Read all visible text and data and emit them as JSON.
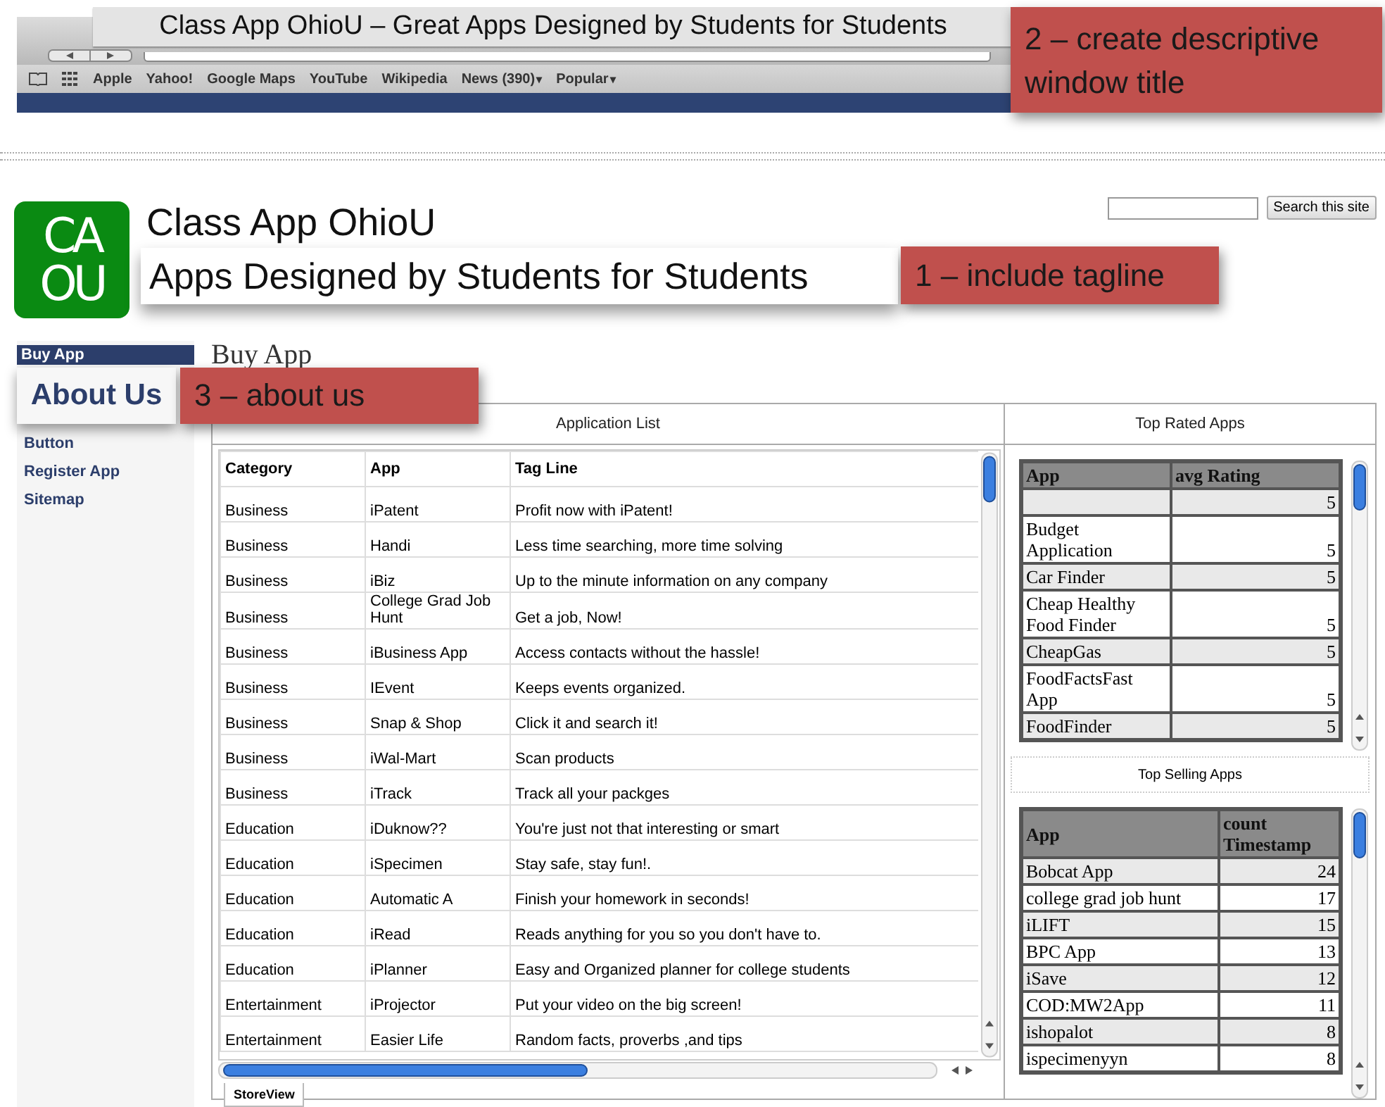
{
  "browser": {
    "window_title": "Class App OhioU – Great Apps Designed by Students for Students",
    "bookmarks": [
      {
        "label": "Apple"
      },
      {
        "label": "Yahoo!"
      },
      {
        "label": "Google Maps"
      },
      {
        "label": "YouTube"
      },
      {
        "label": "Wikipedia"
      },
      {
        "label": "News (390)",
        "caret": "▾"
      },
      {
        "label": "Popular",
        "caret": "▾"
      }
    ]
  },
  "callouts": [
    {
      "kind": "title",
      "text": "2 – create descriptive window title"
    },
    {
      "kind": "tagline",
      "text": "1 – include tagline"
    },
    {
      "kind": "about",
      "text": "3 – about us"
    }
  ],
  "site": {
    "logo_letters": [
      "CA",
      "OU"
    ],
    "title": "Class App OhioU",
    "tagline": "Apps Designed by Students for Students"
  },
  "search": {
    "button": "Search this site"
  },
  "sidebar": {
    "items": [
      {
        "label": "Buy App",
        "selected": true
      },
      {
        "label": "Button",
        "selected": false
      },
      {
        "label": "Register App",
        "selected": false
      },
      {
        "label": "Sitemap",
        "selected": false
      }
    ],
    "highlight": "About Us"
  },
  "page_heading": "Buy App",
  "application_list": {
    "title": "Application List",
    "columns": [
      "Category",
      "App",
      "Tag Line"
    ],
    "rows": [
      [
        "Business",
        "iPatent",
        "Profit now with iPatent!"
      ],
      [
        "Business",
        "Handi",
        "Less time searching, more time solving"
      ],
      [
        "Business",
        "iBiz",
        "Up to the minute information on any company"
      ],
      [
        "Business",
        "College Grad Job Hunt",
        "Get a job, Now!"
      ],
      [
        "Business",
        "iBusiness App",
        "Access contacts without the hassle!"
      ],
      [
        "Business",
        "IEvent",
        "Keeps events organized."
      ],
      [
        "Business",
        "Snap & Shop",
        "Click it and search it!"
      ],
      [
        "Business",
        "iWal-Mart",
        "Scan products"
      ],
      [
        "Business",
        "iTrack",
        "Track all your packges"
      ],
      [
        "Education",
        "iDuknow??",
        "You're just not that interesting or smart"
      ],
      [
        "Education",
        "iSpecimen",
        "Stay safe, stay fun!."
      ],
      [
        "Education",
        "Automatic A",
        "Finish your homework in seconds!"
      ],
      [
        "Education",
        "iRead",
        "Reads anything for you so you don't have to."
      ],
      [
        "Education",
        "iPlanner",
        "Easy and Organized planner for college students"
      ],
      [
        "Entertainment",
        "iProjector",
        "Put your video on the big screen!"
      ],
      [
        "Entertainment",
        "Easier Life",
        "Random facts, proverbs ,and tips"
      ]
    ],
    "tab": "StoreView"
  },
  "top_rated": {
    "title": "Top Rated Apps",
    "columns": [
      "App",
      "avg Rating"
    ],
    "rows": [
      {
        "value": "5"
      },
      {
        "app": "Budget Application",
        "value": "5"
      },
      {
        "app": "Car Finder",
        "value": "5"
      },
      {
        "app": "Cheap Healthy Food Finder",
        "value": "5"
      },
      {
        "app": "CheapGas",
        "value": "5"
      },
      {
        "app": "FoodFactsFast App",
        "value": "5"
      },
      {
        "app": "FoodFinder",
        "value": "5"
      }
    ]
  },
  "top_selling": {
    "title": "Top Selling Apps",
    "columns": [
      "App",
      "count Timestamp"
    ],
    "rows": [
      {
        "app": "Bobcat App",
        "value": "24"
      },
      {
        "app": "college grad job hunt",
        "value": "17"
      },
      {
        "app": "iLIFT",
        "value": "15"
      },
      {
        "app": "BPC App",
        "value": "13"
      },
      {
        "app": "iSave",
        "value": "12"
      },
      {
        "app": "COD:MW2App",
        "value": "11"
      },
      {
        "app": "ishopalot",
        "value": "8"
      },
      {
        "app": "ispecimenyyn",
        "value": "8"
      }
    ]
  }
}
